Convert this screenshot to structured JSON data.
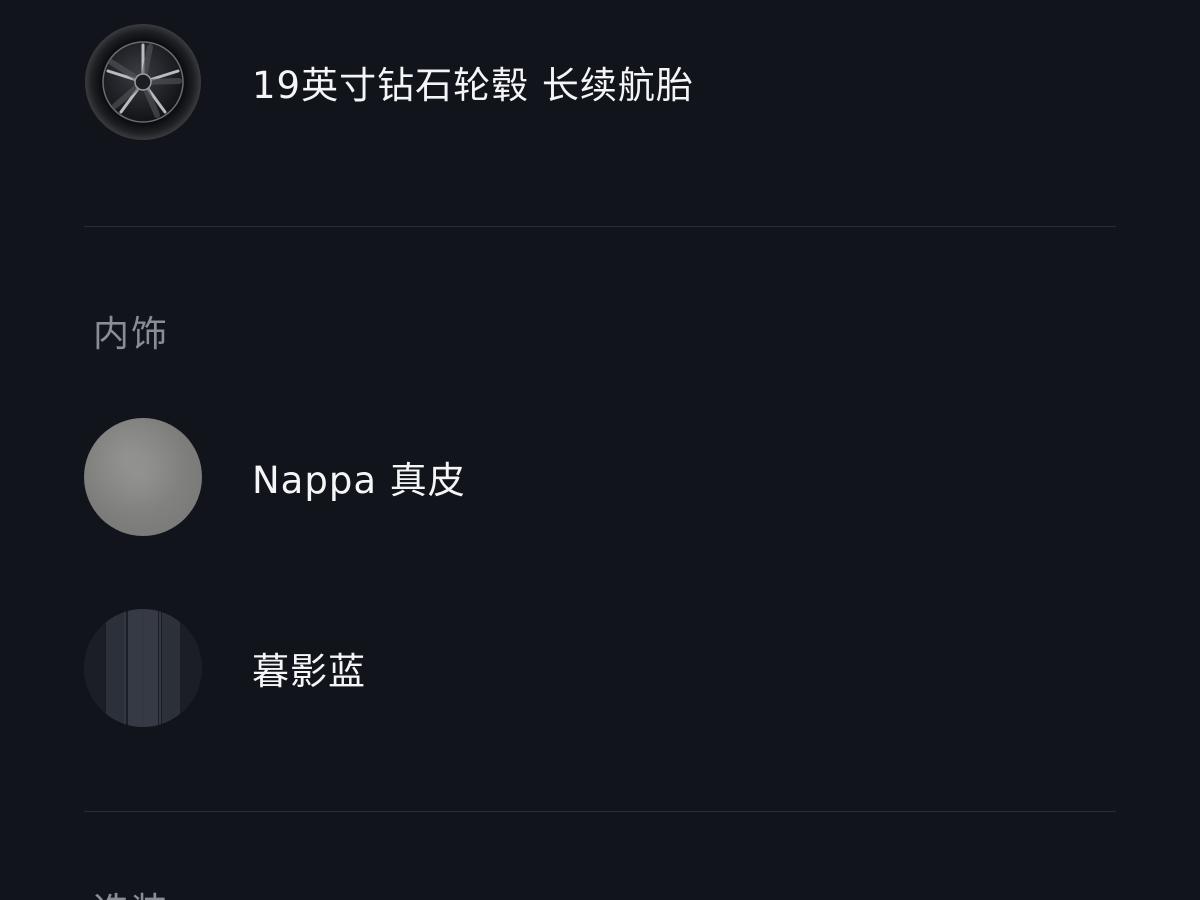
{
  "wheel": {
    "label": "19英寸钻石轮毂 长续航胎",
    "icon": "wheel-icon"
  },
  "interior": {
    "section_title": "内饰",
    "options": [
      {
        "label": "Nappa 真皮",
        "icon": "leather-swatch-icon"
      },
      {
        "label": "暮影蓝",
        "icon": "stripe-swatch-icon"
      }
    ]
  },
  "next_section": {
    "title_partial": "选装"
  },
  "colors": {
    "background": "#12141b",
    "divider": "#2a2d35",
    "text_primary": "#f4f5f7",
    "text_secondary": "#8a8d94"
  }
}
